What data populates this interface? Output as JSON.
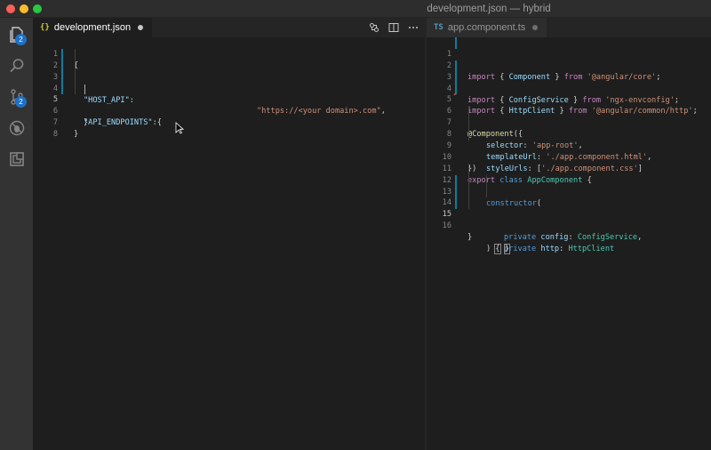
{
  "window": {
    "title": "development.json — hybrid"
  },
  "activity_bar": {
    "items": [
      {
        "icon": "files-icon",
        "badge": "2"
      },
      {
        "icon": "search-icon",
        "badge": ""
      },
      {
        "icon": "source-control-icon",
        "badge": "2"
      },
      {
        "icon": "debug-icon",
        "badge": ""
      },
      {
        "icon": "extensions-icon",
        "badge": ""
      }
    ]
  },
  "left_editor": {
    "tab": {
      "icon_text": "{}",
      "label": "development.json",
      "dirty": true
    },
    "actions": [
      "open-changes-icon",
      "split-editor-icon",
      "more-actions-icon"
    ],
    "lines": [
      {
        "n": "1",
        "text": "{"
      },
      {
        "n": "2",
        "key": "\"HOST_API\"",
        "sep": ":",
        "value": "\"https://<your domain>.com\"",
        "end": ","
      },
      {
        "n": "3",
        "text": ""
      },
      {
        "n": "4",
        "key": "\"API_ENDPOINTS\"",
        "sep": ":{",
        "value": "",
        "end": ""
      },
      {
        "n": "5",
        "text": ""
      },
      {
        "n": "6",
        "text": "}"
      },
      {
        "n": "7",
        "text": "}"
      },
      {
        "n": "8",
        "text": ""
      }
    ]
  },
  "right_editor": {
    "tab": {
      "icon_text": "TS",
      "label": "app.component.ts",
      "dirty": false
    },
    "line_numbers": [
      "1",
      "2",
      "3",
      "4",
      "5",
      "6",
      "7",
      "8",
      "9",
      "10",
      "11",
      "12",
      "13",
      "14",
      "15",
      "16"
    ],
    "code": {
      "l1": [
        "import",
        " { ",
        "Component",
        " } ",
        "from",
        " ",
        "'@angular/core'",
        ";"
      ],
      "l3": [
        "import",
        " { ",
        "ConfigService",
        " } ",
        "from",
        " ",
        "'ngx-envconfig'",
        ";"
      ],
      "l4": [
        "import",
        " { ",
        "HttpClient",
        " } ",
        "from",
        " ",
        "'@angular/common/http'",
        ";"
      ],
      "l6": [
        "@",
        "Component",
        "({"
      ],
      "l7": [
        "selector",
        ": ",
        "'app-root'",
        ","
      ],
      "l8": [
        "templateUrl",
        ": ",
        "'./app.component.html'",
        ","
      ],
      "l9": [
        "styleUrls",
        ": [",
        "'./app.component.css'",
        "]"
      ],
      "l10": [
        "})"
      ],
      "l11": [
        "export",
        " ",
        "class",
        " ",
        "AppComponent",
        " {"
      ],
      "l12": [
        "constructor",
        "("
      ],
      "l13": [
        "private",
        " ",
        "config",
        ": ",
        "ConfigService",
        ","
      ],
      "l14": [
        "private",
        " ",
        "http",
        ": ",
        "HttpClient"
      ],
      "l15": [
        ") ",
        "{",
        " ",
        "}"
      ],
      "l16": [
        "}"
      ]
    }
  },
  "colors": {
    "accent": "#007acc",
    "string": "#ce9178",
    "keyword": "#569cd6",
    "control": "#c586c0",
    "type": "#4ec9b0",
    "property": "#9cdcfe"
  }
}
